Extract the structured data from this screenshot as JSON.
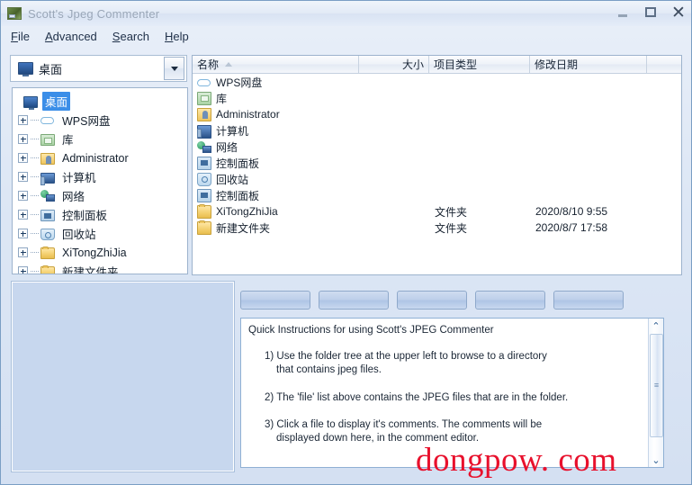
{
  "window": {
    "title": "Scott's Jpeg Commenter",
    "icon": "app-icon",
    "controls": {
      "minimize": "minimize-icon",
      "maximize": "maximize-icon",
      "close": "close-icon"
    }
  },
  "menu": {
    "items": [
      {
        "label": "File",
        "accel": "F",
        "rest": "ile"
      },
      {
        "label": "Advanced",
        "accel": "A",
        "rest": "dvanced"
      },
      {
        "label": "Search",
        "accel": "S",
        "rest": "earch"
      },
      {
        "label": "Help",
        "accel": "H",
        "rest": "elp"
      }
    ]
  },
  "folder_combo": {
    "value": "桌面",
    "icon": "desktop-icon",
    "dropdown_icon": "chevron-down-icon"
  },
  "tree": {
    "items": [
      {
        "label": "桌面",
        "icon": "desktop-icon",
        "selected": true,
        "expandable": false,
        "level": 0
      },
      {
        "label": "WPS网盘",
        "icon": "cloud-icon",
        "selected": false,
        "expandable": true,
        "level": 1
      },
      {
        "label": "库",
        "icon": "library-icon",
        "selected": false,
        "expandable": true,
        "level": 1
      },
      {
        "label": "Administrator",
        "icon": "user-folder-icon",
        "selected": false,
        "expandable": true,
        "level": 1
      },
      {
        "label": "计算机",
        "icon": "computer-icon",
        "selected": false,
        "expandable": true,
        "level": 1
      },
      {
        "label": "网络",
        "icon": "network-icon",
        "selected": false,
        "expandable": true,
        "level": 1
      },
      {
        "label": "控制面板",
        "icon": "control-panel-icon",
        "selected": false,
        "expandable": true,
        "level": 1
      },
      {
        "label": "回收站",
        "icon": "recycle-bin-icon",
        "selected": false,
        "expandable": true,
        "level": 1
      },
      {
        "label": "XiTongZhiJia",
        "icon": "folder-icon",
        "selected": false,
        "expandable": true,
        "level": 1
      },
      {
        "label": "新建文件夹",
        "icon": "folder-icon",
        "selected": false,
        "expandable": true,
        "level": 1
      }
    ]
  },
  "filelist": {
    "columns": [
      {
        "key": "name",
        "label": "名称",
        "sort": "asc"
      },
      {
        "key": "size",
        "label": "大小"
      },
      {
        "key": "type",
        "label": "项目类型"
      },
      {
        "key": "date",
        "label": "修改日期"
      }
    ],
    "rows": [
      {
        "icon": "cloud-icon",
        "name": "WPS网盘",
        "size": "",
        "type": "",
        "date": ""
      },
      {
        "icon": "library-icon",
        "name": "库",
        "size": "",
        "type": "",
        "date": ""
      },
      {
        "icon": "user-folder-icon",
        "name": "Administrator",
        "size": "",
        "type": "",
        "date": ""
      },
      {
        "icon": "computer-icon",
        "name": "计算机",
        "size": "",
        "type": "",
        "date": ""
      },
      {
        "icon": "network-icon",
        "name": "网络",
        "size": "",
        "type": "",
        "date": ""
      },
      {
        "icon": "control-panel-icon",
        "name": "控制面板",
        "size": "",
        "type": "",
        "date": ""
      },
      {
        "icon": "recycle-bin-icon",
        "name": "回收站",
        "size": "",
        "type": "",
        "date": ""
      },
      {
        "icon": "control-panel-icon",
        "name": "控制面板",
        "size": "",
        "type": "",
        "date": ""
      },
      {
        "icon": "folder-icon",
        "name": "XiTongZhiJia",
        "size": "",
        "type": "文件夹",
        "date": "2020/8/10 9:55"
      },
      {
        "icon": "folder-icon",
        "name": "新建文件夹",
        "size": "",
        "type": "文件夹",
        "date": "2020/8/7 17:58"
      }
    ]
  },
  "toolbar": {
    "buttons": [
      {
        "label": "",
        "name": "toolbar-button-1",
        "disabled": true
      },
      {
        "label": "",
        "name": "toolbar-button-2",
        "disabled": true
      },
      {
        "label": "",
        "name": "toolbar-button-3",
        "disabled": true
      },
      {
        "label": "",
        "name": "toolbar-button-4",
        "disabled": true
      },
      {
        "label": "",
        "name": "toolbar-button-5",
        "disabled": true
      }
    ]
  },
  "editor": {
    "title": "Quick Instructions for using Scott's JPEG Commenter",
    "steps": [
      {
        "line1": "1) Use the folder tree at the upper left to  browse to a directory",
        "line2": "that contains jpeg files."
      },
      {
        "line1": "2) The 'file' list above contains the JPEG files  that are in the folder.",
        "line2": ""
      },
      {
        "line1": "3) Click a file to display it's comments. The comments will be",
        "line2": "displayed down here, in the comment editor."
      }
    ],
    "scrollbar": {
      "up": "scroll-up-icon",
      "down": "scroll-down-icon",
      "grip": "≡"
    }
  },
  "watermark": {
    "text": "dongpow. com",
    "color": "#e8112d"
  }
}
